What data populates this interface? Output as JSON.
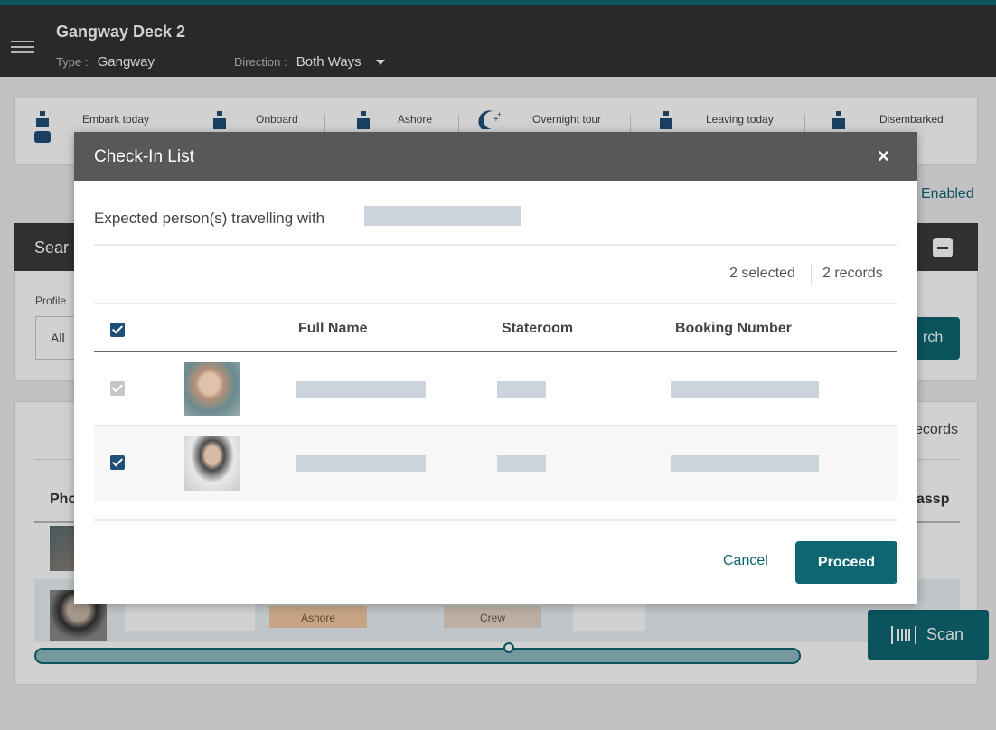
{
  "header": {
    "title": "Gangway Deck 2",
    "type_label": "Type :",
    "type_value": "Gangway",
    "direction_label": "Direction :",
    "direction_value": "Both Ways"
  },
  "stats": [
    {
      "label": "Embark today",
      "icon": "person-icon"
    },
    {
      "label": "Onboard",
      "icon": "person-icon"
    },
    {
      "label": "Ashore",
      "icon": "person-icon"
    },
    {
      "label": "Overnight tour",
      "icon": "moon-icon"
    },
    {
      "label": "Leaving today",
      "icon": "person-icon"
    },
    {
      "label": "Disembarked",
      "icon": "person-icon"
    }
  ],
  "status_link": "Enabled",
  "search": {
    "title": "Sear",
    "profile_label": "Profile",
    "profile_value": "All",
    "button_label": "rch"
  },
  "list": {
    "records_label": "ecords",
    "col_photo": "Pho",
    "col_passport": "assp",
    "badge_status": "Ashore",
    "badge_type": "Crew"
  },
  "scan_button": "Scan",
  "modal": {
    "title": "Check-In List",
    "close": "×",
    "expected_text": "Expected person(s) travelling with",
    "selected": "2 selected",
    "records": "2 records",
    "columns": [
      "Full Name",
      "Stateroom",
      "Booking Number"
    ],
    "rows": [
      {
        "checked": true,
        "disabled": true
      },
      {
        "checked": true,
        "disabled": false
      }
    ],
    "cancel": "Cancel",
    "proceed": "Proceed"
  },
  "colors": {
    "accent": "#0e6672",
    "header_bg": "#323232",
    "modal_header": "#585858",
    "checkbox": "#1f4f77"
  }
}
